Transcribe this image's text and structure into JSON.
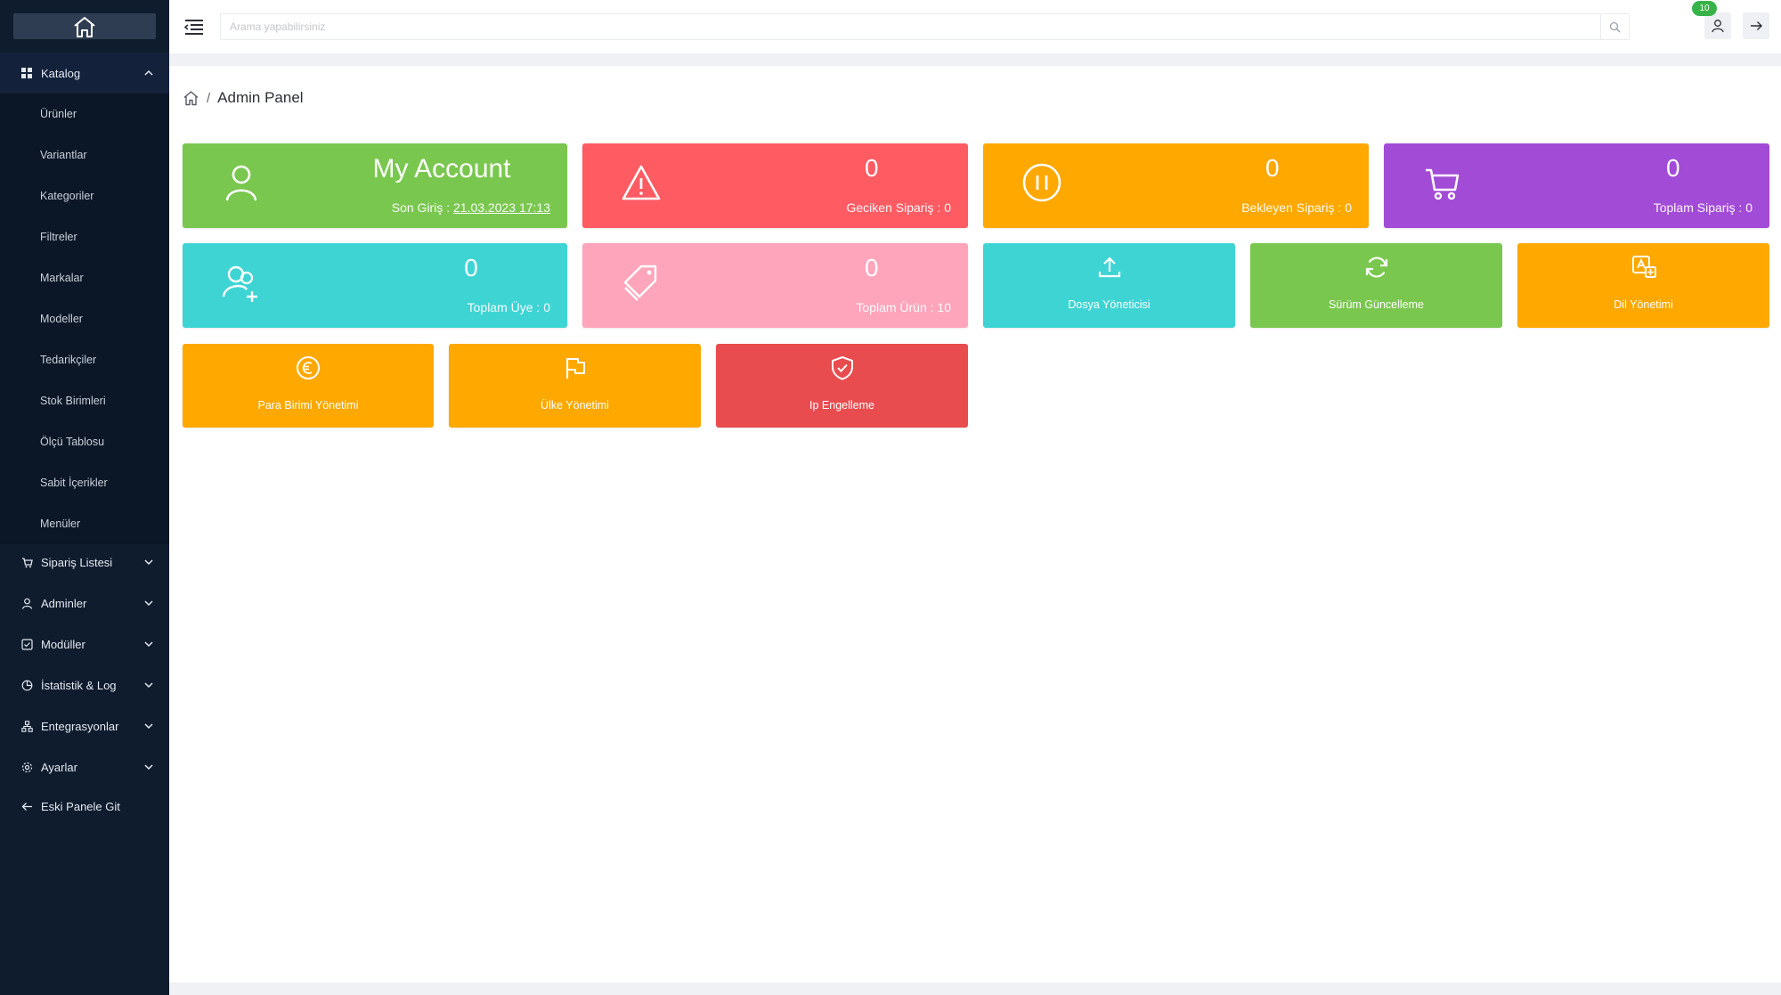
{
  "sidebar": {
    "sections": [
      {
        "label": "Katalog",
        "icon": "grid-icon",
        "expanded": true
      },
      {
        "label": "Sipariş Listesi",
        "icon": "cart-icon"
      },
      {
        "label": "Adminler",
        "icon": "user-icon"
      },
      {
        "label": "Modüller",
        "icon": "checkbox-icon"
      },
      {
        "label": "İstatistik & Log",
        "icon": "pie-chart-icon"
      },
      {
        "label": "Entegrasyonlar",
        "icon": "network-icon"
      },
      {
        "label": "Ayarlar",
        "icon": "gear-icon"
      },
      {
        "label": "Eski Panele Git",
        "icon": "arrow-left-icon"
      }
    ],
    "catalog_items": [
      {
        "label": "Ürünler"
      },
      {
        "label": "Variantlar"
      },
      {
        "label": "Kategoriler"
      },
      {
        "label": "Filtreler"
      },
      {
        "label": "Markalar"
      },
      {
        "label": "Modeller"
      },
      {
        "label": "Tedarikçiler"
      },
      {
        "label": "Stok Birimleri"
      },
      {
        "label": "Ölçü Tablosu"
      },
      {
        "label": "Sabit İçerikler"
      },
      {
        "label": "Menüler"
      }
    ]
  },
  "topbar": {
    "search_placeholder": "Arama yapabilirsiniz",
    "notification_count": "10"
  },
  "breadcrumb": {
    "current": "Admin Panel"
  },
  "stat_cards": {
    "account": {
      "title": "My Account",
      "last_login_label": "Son Giriş :",
      "last_login_value": "21.03.2023 17:13",
      "color": "#7ac74f"
    },
    "delayed": {
      "value": "0",
      "label": "Geciken Sipariş : 0",
      "color": "#ff5b63"
    },
    "pending": {
      "value": "0",
      "label": "Bekleyen Sipariş : 0",
      "color": "#ffa800"
    },
    "total_orders": {
      "value": "0",
      "label": "Toplam Sipariş : 0",
      "color": "#a24bd6"
    },
    "members": {
      "value": "0",
      "label": "Toplam Üye : 0",
      "color": "#3fd4d4"
    },
    "products": {
      "value": "0",
      "label": "Toplam Ürün : 10",
      "color": "#ffa5bb"
    }
  },
  "tiles": {
    "file_manager": {
      "label": "Dosya Yöneticisi",
      "color": "#3fd4d4"
    },
    "version_update": {
      "label": "Sürüm Güncelleme",
      "color": "#7ac74f"
    },
    "language": {
      "label": "Dil Yönetimi",
      "color": "#ffa800"
    },
    "currency": {
      "label": "Para Birimi Yönetimi",
      "color": "#ffa800"
    },
    "country": {
      "label": "Ülke Yönetimi",
      "color": "#ffa800"
    },
    "ip_block": {
      "label": "Ip Engelleme",
      "color": "#e84c4f"
    }
  }
}
